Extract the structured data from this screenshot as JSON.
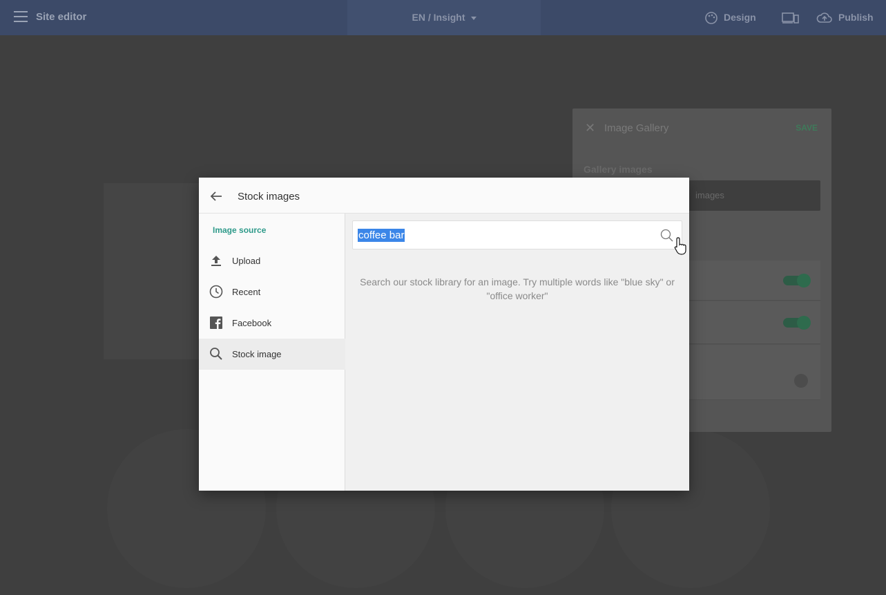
{
  "topbar": {
    "title": "Site editor",
    "language_selector": "EN / Insight",
    "design_label": "Design",
    "publish_label": "Publish"
  },
  "gallery_panel": {
    "title": "Image Gallery",
    "save_label": "SAVE",
    "subtitle": "Gallery images",
    "add_images_label": "images"
  },
  "modal": {
    "title": "Stock images",
    "sidebar": {
      "section_label": "Image source",
      "items": [
        {
          "label": "Upload",
          "icon": "upload-icon"
        },
        {
          "label": "Recent",
          "icon": "clock-icon"
        },
        {
          "label": "Facebook",
          "icon": "facebook-icon"
        },
        {
          "label": "Stock image",
          "icon": "search-icon",
          "active": true
        }
      ]
    },
    "search": {
      "value": "coffee bar",
      "hint": "Search our stock library for an image. Try multiple words like \"blue sky\" or \"office worker\""
    }
  },
  "colors": {
    "accent_teal": "#2e9a8a",
    "topbar": "#3c4a68",
    "selection": "#3b86e8"
  }
}
